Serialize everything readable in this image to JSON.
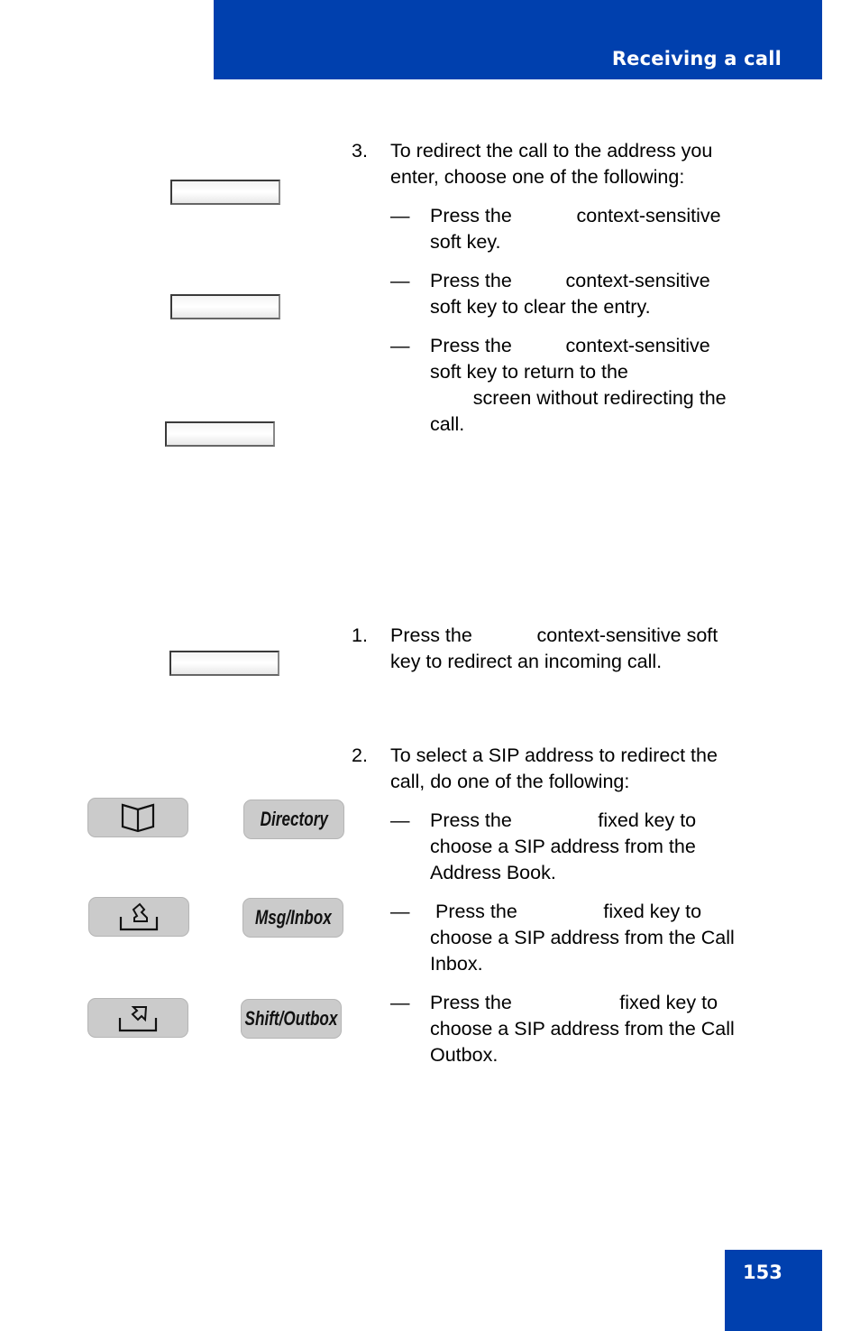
{
  "header": {
    "title": "Receiving a call",
    "color": "#0040ae"
  },
  "page_number": "153",
  "section_top": {
    "step3": {
      "number": "3.",
      "lines": [
        "To redirect the call to the address you",
        "enter, choose one of the following:"
      ]
    },
    "options": [
      {
        "dash": "—",
        "lines": [
          "Press the            context-sensitive",
          "soft key."
        ]
      },
      {
        "dash": "—",
        "lines": [
          "Press the          context-sensitive",
          "soft key to clear the entry."
        ]
      },
      {
        "dash": "—",
        "lines": [
          "Press the          context-sensitive",
          "soft key to return to the",
          "        screen without redirecting the",
          "call."
        ]
      }
    ]
  },
  "section_bottom": {
    "step1": {
      "number": "1.",
      "lines": [
        "Press the            context-sensitive soft",
        "key to redirect an incoming call."
      ]
    },
    "step2": {
      "number": "2.",
      "lines": [
        "To select a SIP address to redirect the",
        "call, do one of the following:"
      ]
    },
    "options": [
      {
        "dash": "—",
        "lines": [
          "Press the                fixed key to",
          "choose a SIP address from the",
          "Address Book."
        ]
      },
      {
        "dash": "—",
        "lines": [
          " Press the                fixed key to",
          "choose a SIP address from the Call",
          "Inbox."
        ]
      },
      {
        "dash": "—",
        "lines": [
          "Press the                    fixed key to",
          "choose a SIP address from the Call",
          "Outbox."
        ]
      }
    ]
  },
  "keys": {
    "directory_label": "Directory",
    "inbox_label": "Msg/Inbox",
    "outbox_label": "Shift/Outbox",
    "directory_icon": "book-icon",
    "inbox_icon": "tray-in-icon",
    "outbox_icon": "tray-out-icon"
  }
}
